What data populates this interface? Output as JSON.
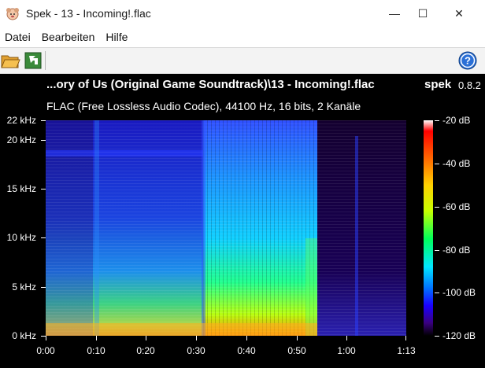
{
  "window": {
    "title": "Spek - 13 - Incoming!.flac",
    "minimize": "—",
    "maximize": "☐",
    "close": "✕"
  },
  "menu": {
    "items": [
      "Datei",
      "Bearbeiten",
      "Hilfe"
    ]
  },
  "toolbar": {
    "icons": [
      "folder-open-icon",
      "save-export-icon",
      "help-icon"
    ],
    "help_glyph": "?"
  },
  "spectrogram": {
    "file_title": "...ory of Us (Original Game Soundtrack)\\13 - Incoming!.flac",
    "app_name": "spek",
    "version": "0.8.2",
    "file_info": "FLAC (Free Lossless Audio Codec), 44100 Hz, 16 bits, 2 Kanäle",
    "y_labels": [
      "22 kHz",
      "20 kHz",
      "15 kHz",
      "10 kHz",
      "5 kHz",
      "0 kHz"
    ],
    "x_labels": [
      "0:00",
      "0:10",
      "0:20",
      "0:30",
      "0:40",
      "0:50",
      "1:00",
      "1:13"
    ],
    "db_labels": [
      "-20 dB",
      "-40 dB",
      "-60 dB",
      "-80 dB",
      "-100 dB",
      "-120 dB"
    ],
    "colors": {
      "background": "#000000",
      "low": "#3a0080",
      "mid": "#00ff5a",
      "high": "#ff0000"
    }
  }
}
